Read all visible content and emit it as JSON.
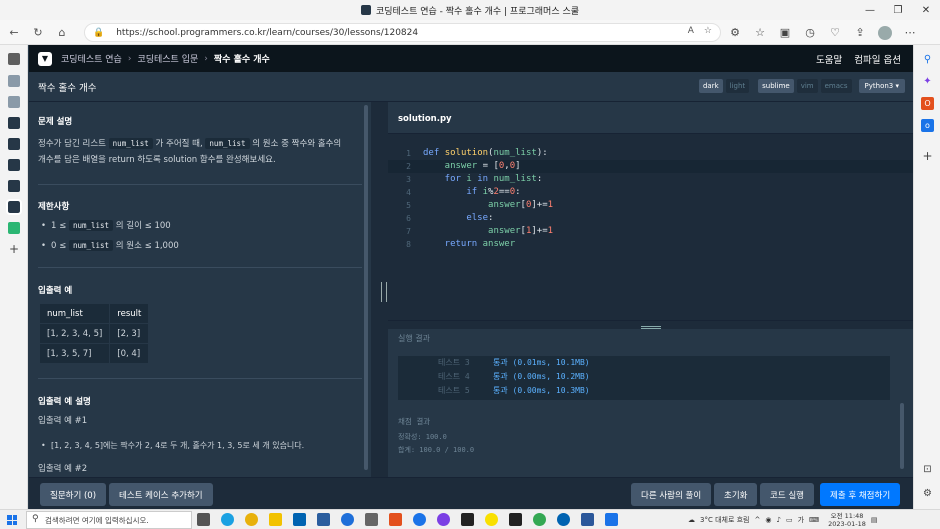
{
  "window": {
    "title": "코딩테스트 연습 - 짝수 홀수 개수 | 프로그래머스 스쿨",
    "controls": [
      "—",
      "❐",
      "✕"
    ]
  },
  "browser": {
    "url": "https://school.programmers.co.kr/learn/courses/30/lessons/120824",
    "nav_icons": [
      "back-icon",
      "refresh-icon",
      "home-icon"
    ]
  },
  "header": {
    "breadcrumb": [
      "코딩테스트 연습",
      "코딩테스트 입문",
      "짝수 홀수 개수"
    ],
    "help": "도움말",
    "compile_options": "컴파일 옵션"
  },
  "lesson": {
    "title": "짝수 홀수 개수",
    "themes": [
      "dark",
      "light"
    ],
    "keymaps": [
      "sublime",
      "vim",
      "emacs"
    ],
    "language": "Python3"
  },
  "problem": {
    "desc_title": "문제 설명",
    "desc_p1": "정수가 담긴 리스트 ",
    "desc_code1": "num_list",
    "desc_p2": " 가 주어질 때, ",
    "desc_code2": "num_list",
    "desc_p3": " 의 원소 중 짝수와 홀수의",
    "desc_p4": "개수를 담은 배열을 return 하도록 solution 함수를 완성해보세요.",
    "limits_title": "제한사항",
    "limit1_a": "1 ≤ ",
    "limit1_code": "num_list",
    "limit1_b": " 의 길이 ≤ 100",
    "limit2_a": "0 ≤ ",
    "limit2_code": "num_list",
    "limit2_b": " 의 원소 ≤ 1,000",
    "io_title": "입출력 예",
    "io_headers": [
      "num_list",
      "result"
    ],
    "io_rows": [
      [
        "[1, 2, 3, 4, 5]",
        "[2, 3]"
      ],
      [
        "[1, 3, 5, 7]",
        "[0, 4]"
      ]
    ],
    "io_desc_title": "입출력 예 설명",
    "ex1_title": "입출력 예 #1",
    "ex1_bullet": "[1, 2, 3, 4, 5]에는 짝수가 2, 4로 두 개, 홀수가 1, 3, 5로 세 개 있습니다.",
    "ex2_title": "입출력 예 #2"
  },
  "editor": {
    "filename": "solution.py",
    "lines": [
      [
        {
          "c": "kw",
          "t": "def "
        },
        {
          "c": "fn",
          "t": "solution"
        },
        {
          "c": "op",
          "t": "("
        },
        {
          "c": "id",
          "t": "num_list"
        },
        {
          "c": "op",
          "t": "):"
        }
      ],
      [
        {
          "c": "id",
          "t": "    answer "
        },
        {
          "c": "op",
          "t": "= ["
        },
        {
          "c": "num",
          "t": "0"
        },
        {
          "c": "op",
          "t": ","
        },
        {
          "c": "num",
          "t": "0"
        },
        {
          "c": "op",
          "t": "]"
        }
      ],
      [
        {
          "c": "kw",
          "t": "    for "
        },
        {
          "c": "id",
          "t": "i "
        },
        {
          "c": "kw",
          "t": "in "
        },
        {
          "c": "id",
          "t": "num_list"
        },
        {
          "c": "op",
          "t": ":"
        }
      ],
      [
        {
          "c": "kw",
          "t": "        if "
        },
        {
          "c": "id",
          "t": "i"
        },
        {
          "c": "op",
          "t": "%"
        },
        {
          "c": "num",
          "t": "2"
        },
        {
          "c": "op",
          "t": "=="
        },
        {
          "c": "num",
          "t": "0"
        },
        {
          "c": "op",
          "t": ":"
        }
      ],
      [
        {
          "c": "id",
          "t": "            answer"
        },
        {
          "c": "op",
          "t": "["
        },
        {
          "c": "num",
          "t": "0"
        },
        {
          "c": "op",
          "t": "]+="
        },
        {
          "c": "num",
          "t": "1"
        }
      ],
      [
        {
          "c": "kw",
          "t": "        else"
        },
        {
          "c": "op",
          "t": ":"
        }
      ],
      [
        {
          "c": "id",
          "t": "            answer"
        },
        {
          "c": "op",
          "t": "["
        },
        {
          "c": "num",
          "t": "1"
        },
        {
          "c": "op",
          "t": "]+="
        },
        {
          "c": "num",
          "t": "1"
        }
      ],
      [
        {
          "c": "kw",
          "t": "    return "
        },
        {
          "c": "id",
          "t": "answer"
        }
      ]
    ],
    "line_numbers": [
      "1",
      "2",
      "3",
      "4",
      "5",
      "6",
      "7",
      "8"
    ]
  },
  "result": {
    "title": "실행 결과",
    "tests": [
      {
        "name": "테스트 3",
        "status": "통과 (0.01ms, 10.1MB)"
      },
      {
        "name": "테스트 4",
        "status": "통과 (0.00ms, 10.2MB)"
      },
      {
        "name": "테스트 5",
        "status": "통과 (0.00ms, 10.3MB)"
      }
    ],
    "grade_title": "채점 결과",
    "accuracy": "정확성: 100.0",
    "total": "합계: 100.0 / 100.0"
  },
  "bottom": {
    "ask": "질문하기 (0)",
    "add_testcase": "테스트 케이스 추가하기",
    "others": "다른 사람의 풀이",
    "reset": "초기화",
    "run": "코드 실행",
    "submit": "제출 후 채점하기"
  },
  "taskbar": {
    "search_placeholder": "검색하려면 여기에 입력하십시오.",
    "weather": "3°C 대체로 흐림",
    "time": "오전 11:48",
    "date": "2023-01-18"
  },
  "colors": {
    "bg": "#263747",
    "header": "#0c151c",
    "accent": "#0078ff"
  }
}
